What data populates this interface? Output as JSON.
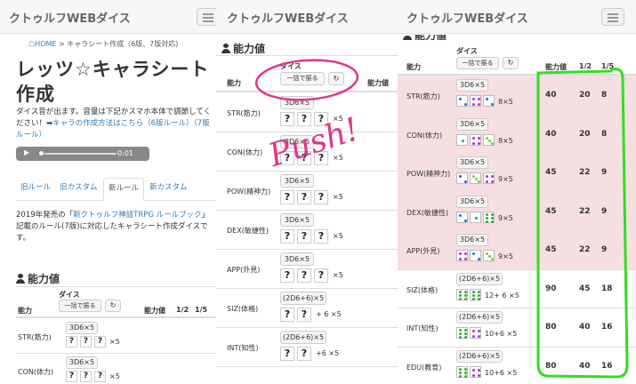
{
  "site_title": "クトゥルフWEBダイス",
  "breadcrumb": {
    "home": "HOME",
    "sep": " > ",
    "current": "キャラシート作成（6版、7版対応)"
  },
  "page_title": "レッツ☆キャラシート作成",
  "intro": {
    "text": "ダイス音が出ます。音量は下記かスマホ本体で調節してください！➡",
    "link": "キャラの作成方法はこちら（6版ルール）（7版ルール）"
  },
  "audio": {
    "time": "-0:01"
  },
  "tabs": [
    "旧ルール",
    "旧カスタム",
    "新ルール",
    "新カスタム"
  ],
  "description": {
    "prefix": "2019年発売の「",
    "link": "新クトゥルフ神話TRPG ルールブック",
    "suffix": "」記載のルール(7版)に対応したキャラシート作成ダイスです。"
  },
  "section_title": "能力値",
  "table": {
    "col_ability": "能力",
    "col_dice": "ダイス",
    "roll_all_button": "一括で振る",
    "col_value": "能力値",
    "col_half": "1/2",
    "col_fifth": "1/5"
  },
  "rows_unrolled": [
    {
      "label": "STR(筋力)",
      "dice": "3D6×5",
      "q": "?",
      "mult": "×5"
    },
    {
      "label": "CON(体力)",
      "dice": "3D6×5",
      "q": "?",
      "mult": "×5"
    },
    {
      "label": "POW(精神力)",
      "dice": "3D6×5",
      "q": "?",
      "mult": "×5"
    },
    {
      "label": "DEX(敏捷性)",
      "dice": "3D6×5",
      "q": "?",
      "mult": "×5"
    },
    {
      "label": "APP(外見)",
      "dice": "3D6×5",
      "q": "?",
      "mult": "×5"
    },
    {
      "label": "SIZ(体格)",
      "dice": "(2D6+6)×5",
      "q": "?",
      "mult": "+ 6 ×5"
    },
    {
      "label": "INT(知性)",
      "dice": "(2D6+6)×5",
      "q": "?",
      "mult": "+6 ×5"
    }
  ],
  "annotation": {
    "text": "Push!",
    "color": "#e0368a"
  },
  "highlight_color": "#33dd22",
  "rows_rolled": [
    {
      "label": "STR(筋力)",
      "dice": "3D6×5",
      "dice_sum": "8×5",
      "value": "40",
      "half": "20",
      "fifth": "8",
      "faces": [
        2,
        4,
        2
      ]
    },
    {
      "label": "CON(体力)",
      "dice": "3D6×5",
      "dice_sum": "8×5",
      "value": "40",
      "half": "20",
      "fifth": "8",
      "faces": [
        1,
        4,
        3
      ]
    },
    {
      "label": "POW(精神力)",
      "dice": "3D6×5",
      "dice_sum": "9×5",
      "value": "45",
      "half": "22",
      "fifth": "9",
      "faces": [
        2,
        3,
        4
      ]
    },
    {
      "label": "DEX(敏捷性)",
      "dice": "3D6×5",
      "dice_sum": "9×5",
      "value": "45",
      "half": "22",
      "fifth": "9",
      "faces": [
        2,
        1,
        6
      ]
    },
    {
      "label": "APP(外見)",
      "dice": "3D6×5",
      "dice_sum": "9×5",
      "value": "45",
      "half": "22",
      "fifth": "9",
      "faces": [
        4,
        2,
        3
      ]
    },
    {
      "label": "SIZ(体格)",
      "dice": "(2D6+6)×5",
      "dice_sum": "12+ 6 ×5",
      "value": "90",
      "half": "45",
      "fifth": "18",
      "faces": [
        6,
        6
      ]
    },
    {
      "label": "INT(知性)",
      "dice": "(2D6+6)×5",
      "dice_sum": "10+6 ×5",
      "value": "80",
      "half": "40",
      "fifth": "16",
      "faces": [
        6,
        4
      ]
    },
    {
      "label": "EDU(教育)",
      "dice": "(2D6+6)×5",
      "dice_sum": "10+6 ×5",
      "value": "80",
      "half": "40",
      "fifth": "16",
      "faces": [
        6,
        4
      ]
    }
  ]
}
